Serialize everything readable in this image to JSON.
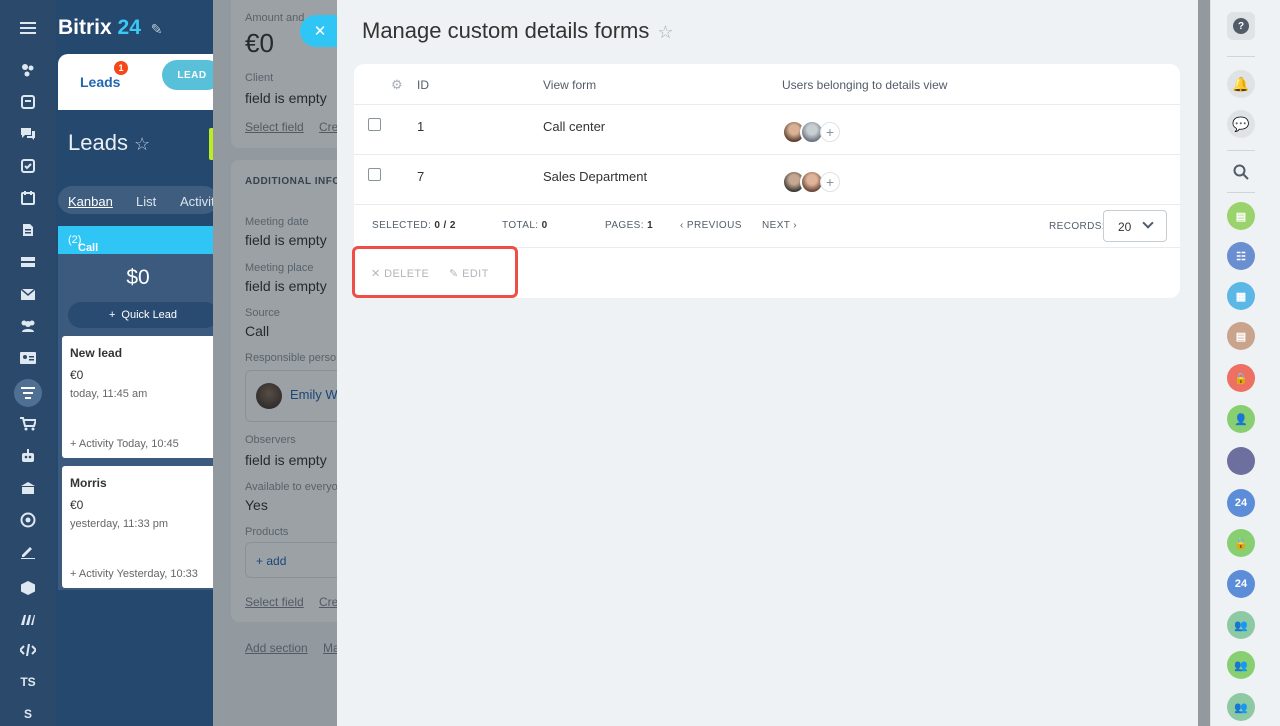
{
  "portal": {
    "logo_main": "Bitrix",
    "logo_num": "24",
    "tab_label": "Leads",
    "tab_badge": "1",
    "stage_pill": "LEAD",
    "page_title": "Leads",
    "views": {
      "kanban": "Kanban",
      "list": "List",
      "activities": "Activiti"
    },
    "column": {
      "title": "Call center",
      "count": "(2)",
      "sum": "$0",
      "quick_lead": "Quick Lead"
    },
    "cards": [
      {
        "title": "New lead",
        "amount": "€0",
        "date": "today, 11:45 am",
        "footer": "+ Activity   Today, 10:45"
      },
      {
        "title": "Morris",
        "amount": "€0",
        "date": "yesterday, 11:33 pm",
        "footer": "+ Activity Yesterday, 10:33"
      }
    ],
    "left_nav_texts": {
      "ts": "TS",
      "s": "S"
    }
  },
  "lead_details": {
    "amount_label": "Amount and",
    "amount_value": "€0",
    "client_label": "Client",
    "client_value": "field is empty",
    "select_field": "Select field",
    "create_short": "Cre",
    "section_header": "ADDITIONAL INFO",
    "meeting_date_label": "Meeting date",
    "meeting_date_value": "field is empty",
    "meeting_place_label": "Meeting place",
    "meeting_place_value": "field is empty",
    "source_label": "Source",
    "source_value": "Call",
    "responsible_label": "Responsible perso",
    "responsible_name": "Emily W",
    "observers_label": "Observers",
    "observers_value": "field is empty",
    "available_label": "Available to everyo",
    "available_value": "Yes",
    "products_label": "Products",
    "products_add": "+ add",
    "select_field_2": "Select field",
    "create_short_2": "Cre",
    "add_section": "Add section",
    "ma": "Ma"
  },
  "slider": {
    "title": "Manage custom details forms",
    "columns": {
      "id": "ID",
      "view_form": "View form",
      "users": "Users belonging to details view"
    },
    "rows": [
      {
        "id": "1",
        "view_form": "Call center"
      },
      {
        "id": "7",
        "view_form": "Sales Department"
      }
    ],
    "footer": {
      "selected_label": "SELECTED:",
      "selected_value": "0 / 2",
      "total_label": "TOTAL:",
      "total_value": "0",
      "pages_label": "PAGES:",
      "pages_value": "1",
      "previous": "PREVIOUS",
      "next": "NEXT",
      "records_label": "RECORDS:",
      "records_value": "20"
    },
    "actions": {
      "delete": "DELETE",
      "edit": "EDIT"
    }
  },
  "right_bar": {
    "help": "?",
    "b24_label_1": "24",
    "b24_label_2": "24"
  },
  "colors": {
    "accent": "#2fc6f6",
    "highlight": "#ee4e47",
    "link": "#2067b0"
  }
}
